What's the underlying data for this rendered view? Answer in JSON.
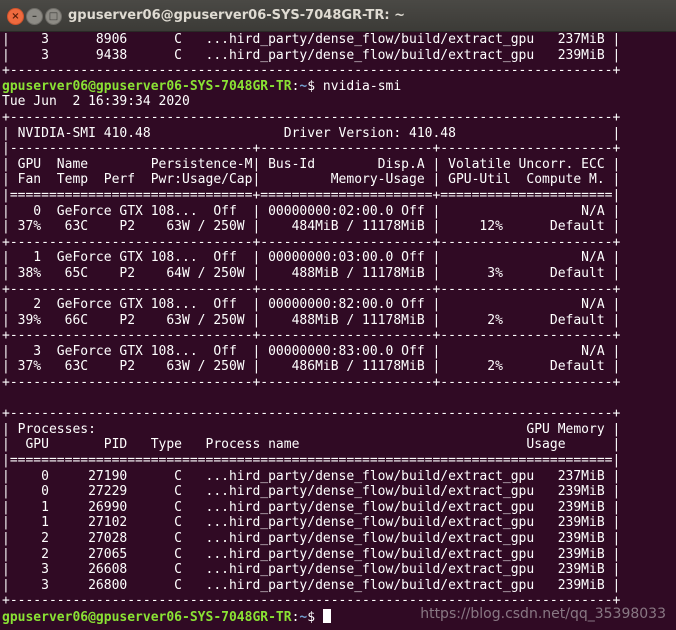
{
  "window": {
    "title": "gpuserver06@gpuserver06-SYS-7048GR-TR: ~",
    "close_glyph": "×",
    "minimize_glyph": "–",
    "maximize_glyph": "□"
  },
  "prompt": {
    "user_host": "gpuserver06@gpuserver06-SYS-7048GR-TR",
    "separator": ":",
    "path": "~",
    "symbol": "$ "
  },
  "command": "nvidia-smi",
  "scrollback_lines": [
    "|    3      8906      C   ...hird_party/dense_flow/build/extract_gpu   237MiB |",
    "|    3      9438      C   ...hird_party/dense_flow/build/extract_gpu   239MiB |",
    "+-----------------------------------------------------------------------------+"
  ],
  "output_lines": [
    "Tue Jun  2 16:39:34 2020",
    "+-----------------------------------------------------------------------------+",
    "| NVIDIA-SMI 410.48                 Driver Version: 410.48                    |",
    "|-------------------------------+----------------------+----------------------+",
    "| GPU  Name        Persistence-M| Bus-Id        Disp.A | Volatile Uncorr. ECC |",
    "| Fan  Temp  Perf  Pwr:Usage/Cap|         Memory-Usage | GPU-Util  Compute M. |",
    "|===============================+======================+======================|",
    "|   0  GeForce GTX 108...  Off  | 00000000:02:00.0 Off |                  N/A |",
    "| 37%   63C    P2    63W / 250W |    484MiB / 11178MiB |     12%      Default |",
    "+-------------------------------+----------------------+----------------------+",
    "|   1  GeForce GTX 108...  Off  | 00000000:03:00.0 Off |                  N/A |",
    "| 38%   65C    P2    64W / 250W |    488MiB / 11178MiB |      3%      Default |",
    "+-------------------------------+----------------------+----------------------+",
    "|   2  GeForce GTX 108...  Off  | 00000000:82:00.0 Off |                  N/A |",
    "| 39%   66C    P2    63W / 250W |    488MiB / 11178MiB |      2%      Default |",
    "+-------------------------------+----------------------+----------------------+",
    "|   3  GeForce GTX 108...  Off  | 00000000:83:00.0 Off |                  N/A |",
    "| 37%   63C    P2    63W / 250W |    486MiB / 11178MiB |      2%      Default |",
    "+-------------------------------+----------------------+----------------------+",
    "",
    "+-----------------------------------------------------------------------------+",
    "| Processes:                                                       GPU Memory |",
    "|  GPU       PID   Type   Process name                             Usage      |",
    "|=============================================================================|",
    "|    0     27190      C   ...hird_party/dense_flow/build/extract_gpu   237MiB |",
    "|    0     27229      C   ...hird_party/dense_flow/build/extract_gpu   239MiB |",
    "|    1     26990      C   ...hird_party/dense_flow/build/extract_gpu   239MiB |",
    "|    1     27102      C   ...hird_party/dense_flow/build/extract_gpu   239MiB |",
    "|    2     27028      C   ...hird_party/dense_flow/build/extract_gpu   239MiB |",
    "|    2     27065      C   ...hird_party/dense_flow/build/extract_gpu   239MiB |",
    "|    3     26608      C   ...hird_party/dense_flow/build/extract_gpu   239MiB |",
    "|    3     26800      C   ...hird_party/dense_flow/build/extract_gpu   239MiB |",
    "+-----------------------------------------------------------------------------+"
  ],
  "watermark": "https://blog.csdn.net/qq_35398033",
  "colors": {
    "background": "#300a24",
    "prompt_user": "#8ae234",
    "prompt_path": "#729fcf",
    "text": "#ffffff"
  }
}
